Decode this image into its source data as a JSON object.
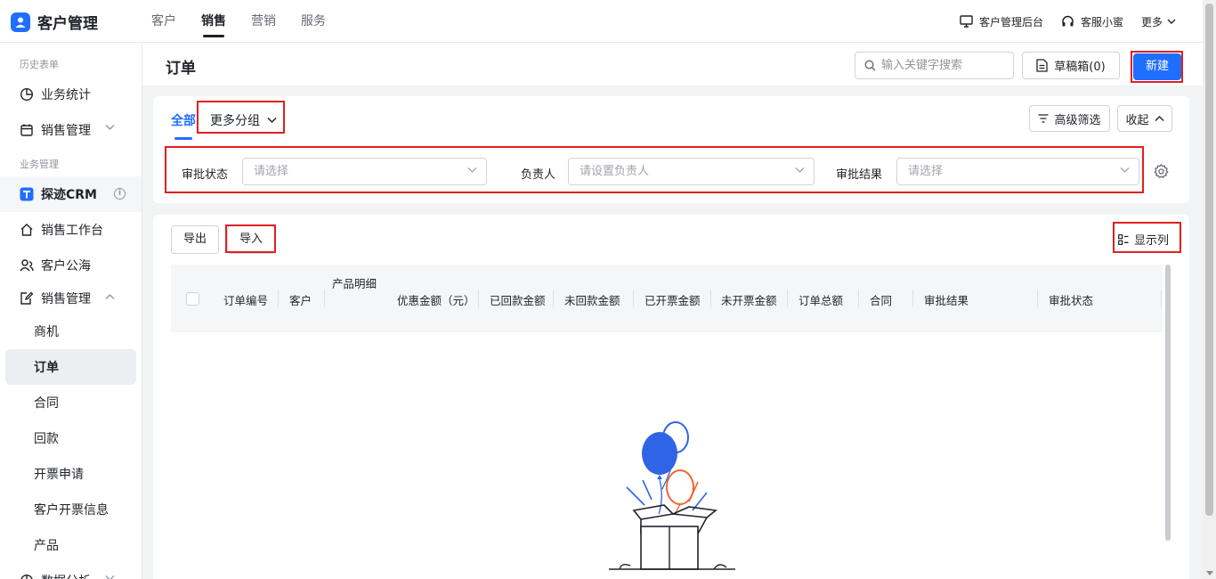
{
  "app": {
    "title": "客户管理"
  },
  "topnav": [
    {
      "label": "客户",
      "active": false
    },
    {
      "label": "销售",
      "active": true
    },
    {
      "label": "营销",
      "active": false
    },
    {
      "label": "服务",
      "active": false
    }
  ],
  "topright": {
    "admin_label": "客户管理后台",
    "service_label": "客服小蜜",
    "more_label": "更多"
  },
  "sidebar": {
    "group_history": "历史表单",
    "item_stats": "业务统计",
    "item_sales_mgmt_1": "销售管理",
    "group_business": "业务管理",
    "item_crm": "探迹CRM",
    "item_workbench": "销售工作台",
    "item_pool": "客户公海",
    "item_sales_mgmt_2": "销售管理",
    "sub_items": [
      "商机",
      "订单",
      "合同",
      "回款",
      "开票申请",
      "客户开票信息",
      "产品"
    ],
    "selected_sub": "订单",
    "item_analysis": "数据分析"
  },
  "header": {
    "page_title": "订单",
    "search_placeholder": "输入关键字搜索",
    "draft_label": "草稿箱(0)",
    "new_label": "新建"
  },
  "filter": {
    "tab_all": "全部",
    "tab_more": "更多分组",
    "advanced_label": "高级筛选",
    "collapse_label": "收起",
    "fields": [
      {
        "label": "审批状态",
        "placeholder": "请选择"
      },
      {
        "label": "负责人",
        "placeholder": "请设置负责人"
      },
      {
        "label": "审批结果",
        "placeholder": "请选择"
      }
    ]
  },
  "table": {
    "export_label": "导出",
    "import_label": "导入",
    "columns_label": "显示列",
    "columns": [
      "订单编号",
      "客户",
      "产品明细",
      "优惠金额（元）",
      "已回款金额",
      "未回款金额",
      "已开票金额",
      "未开票金额",
      "订单总额",
      "合同",
      "审批结果",
      "审批状态"
    ],
    "rows": []
  },
  "colors": {
    "accent": "#1f6fff",
    "highlight_box": "#e02020",
    "balloon_blue": "#2f64e6",
    "balloon_orange": "#f0652f"
  }
}
